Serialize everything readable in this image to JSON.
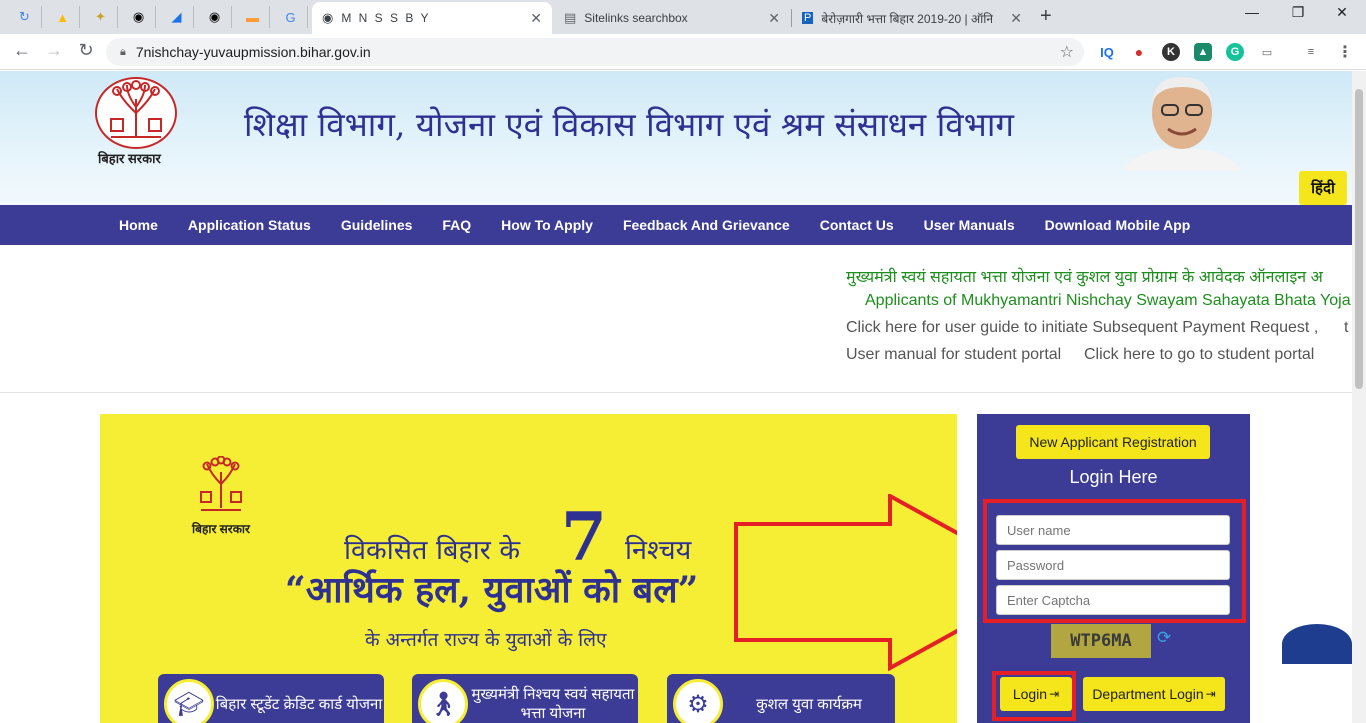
{
  "browser": {
    "tabs": [
      {
        "title": "M N S S B Y",
        "active": true
      },
      {
        "title": "Sitelinks searchbox",
        "active": false
      },
      {
        "title": "बेरोज़गारी भत्ता बिहार 2019-20 | ऑनि",
        "active": false
      }
    ],
    "url": "7nishchay-yuvaupmission.bihar.gov.in"
  },
  "header": {
    "logo_text": "बिहार सरकार",
    "title": "शिक्षा विभाग, योजना एवं विकास विभाग एवं श्रम संसाधन विभाग",
    "lang_button": "हिंदी"
  },
  "nav": {
    "items": [
      "Home",
      "Application Status",
      "Guidelines",
      "FAQ",
      "How To Apply",
      "Feedback And Grievance",
      "Contact Us",
      "User Manuals",
      "Download Mobile App"
    ]
  },
  "ticker": {
    "line1": "मुख्यमंत्री स्वयं सहायता भत्ता योजना एवं कुशल युवा प्रोग्राम के आवेदक ऑनलाइन अ",
    "line2": "Applicants of Mukhyamantri Nishchay Swayam Sahayata Bhata Yoja",
    "line3a": "Click here for user guide to initiate Subsequent Payment Request ,",
    "line3b": "t",
    "line4a": "User manual for student portal",
    "line4b": "Click here to go to student portal"
  },
  "banner": {
    "logo_text": "बिहार सरकार",
    "line1_prefix": "विकसित बिहार के",
    "seven": "7",
    "line1_suffix": "निश्चय",
    "line2": "“आर्थिक हल, युवाओं को बल”",
    "line3": "के अन्तर्गत राज्य के युवाओं के लिए",
    "schemes": [
      {
        "label": "बिहार स्टूडेंट क्रेडिट कार्ड योजना"
      },
      {
        "label": "मुख्यमंत्री निश्चय स्वयं सहायता भत्ता योजना"
      },
      {
        "label": "कुशल युवा कार्यक्रम"
      }
    ]
  },
  "login": {
    "new_registration": "New Applicant Registration",
    "heading": "Login Here",
    "username_placeholder": "User name",
    "password_placeholder": "Password",
    "captcha_placeholder": "Enter Captcha",
    "captcha_text": "WTP6MA",
    "login_button": "Login",
    "dept_login_button": "Department Login"
  },
  "colors": {
    "navbar": "#3c3c96",
    "accent_yellow": "#f5e61c",
    "highlight_red": "#e41f26",
    "ticker_green": "#1e8e1e"
  }
}
